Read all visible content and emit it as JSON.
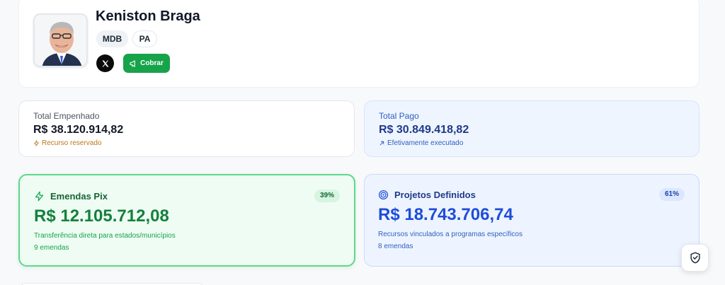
{
  "profile": {
    "name": "Keniston Braga",
    "party": "MDB",
    "state": "PA",
    "x_icon": "x-logo-icon",
    "cobrar_label": "Cobrar",
    "cobrar_icon": "megaphone-icon"
  },
  "summary": {
    "empenhado": {
      "label": "Total Empenhado",
      "value": "R$ 38.120.914,82",
      "note": "Recurso reservado",
      "icon": "lightning-icon"
    },
    "pago": {
      "label": "Total Pago",
      "value": "R$ 30.849.418,82",
      "note": "Efetivamente executado",
      "icon": "arrow-up-right-icon"
    }
  },
  "cards": {
    "pix": {
      "title": "Emendas Pix",
      "percent": "39%",
      "value": "R$ 12.105.712,08",
      "description": "Transferência direta para estados/municípios",
      "count": "9 emendas",
      "icon": "lightning-icon"
    },
    "projetos": {
      "title": "Projetos Definidos",
      "percent": "61%",
      "value": "R$ 18.743.706,74",
      "description": "Recursos vinculados a programas específicos",
      "count": "8 emendas",
      "icon": "target-icon"
    }
  },
  "floating": {
    "icon": "shield-check-icon"
  },
  "colors": {
    "green": "#16a34a",
    "blue": "#1d4ed8",
    "amber": "#b7791f"
  }
}
